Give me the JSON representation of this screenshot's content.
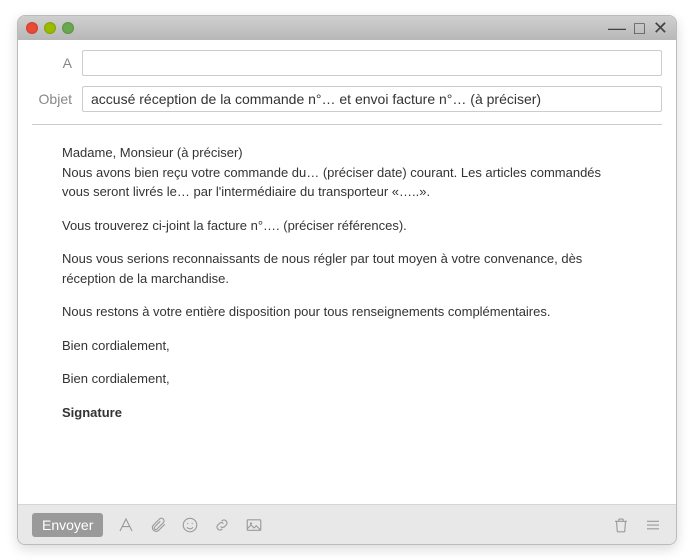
{
  "titlebar": {
    "minimize": "—",
    "maximize": "□",
    "close": "✕"
  },
  "header": {
    "to_label": "A",
    "to_value": "",
    "subject_label": "Objet",
    "subject_value": "accusé réception de la commande n°… et envoi facture n°… (à préciser)"
  },
  "body": {
    "p1": "Madame, Monsieur (à préciser)\nNous avons bien reçu votre commande du… (préciser date) courant. Les articles commandés vous seront livrés le… par l'intermédiaire du transporteur «…..».",
    "p2": "Vous trouverez ci-joint la facture n°…. (préciser références).",
    "p3": "Nous vous serions reconnaissants de nous régler par tout moyen à votre convenance, dès réception de la marchandise.",
    "p4": "Nous restons à votre entière disposition pour tous renseignements complémentaires.",
    "p5": "Bien cordialement,",
    "p6": "Bien cordialement,",
    "signature": "Signature"
  },
  "toolbar": {
    "send_label": "Envoyer"
  }
}
